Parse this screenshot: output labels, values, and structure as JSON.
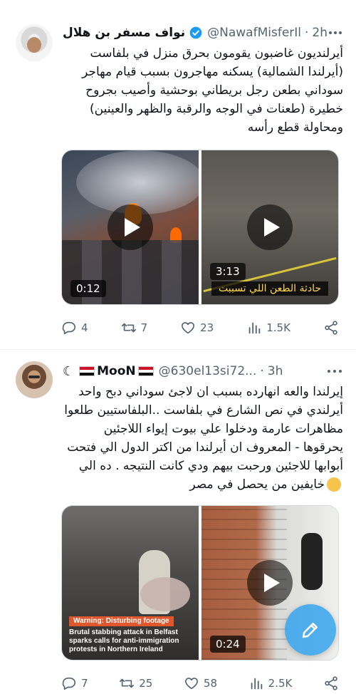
{
  "tweets": [
    {
      "author_name": "نواف مسفر بن هلال",
      "handle": "@NawafMisferIl",
      "time": "2h",
      "body_lines": [
        "أيرلنديون غاضبون يقومون بحرق منزل في بلفاست",
        "(أيرلندا الشمالية) يسكنه مهاجرون بسبب قيام مهاجر",
        "سوداني بطعن رجل بريطاني بوحشية وأصيب بجروح",
        "خطيرة (طعنات في الوجه والرقبة والظهر والعينين)",
        "ومحاولة قطع رأسه"
      ],
      "videos": [
        {
          "duration": "0:12"
        },
        {
          "duration": "3:13",
          "caption": "حادثة الطعن اللي تسببت"
        }
      ],
      "stats": {
        "replies": "4",
        "reposts": "7",
        "likes": "23",
        "views": "1.5K"
      }
    },
    {
      "author_name": "MooN",
      "handle": "@630el13si72...",
      "time": "3h",
      "body_lines": [
        "إيرلندا والعه انهارده بسبب ان لاجئ سوداني دبح واحد",
        "أيرلندي في نص الشارع في بلفاست ..البلفاستيين طلعوا",
        "مظاهرات عارمة ودخلوا علي بيوت إيواء اللاجئين",
        "يحرقوها - المعروف ان أيرلندا من اكتر الدول الي فتحت",
        "أبوابها للاجئين ورحبت بيهم ودي كانت النتيجه . ده الي",
        "خايفين من يحصل في مصر"
      ],
      "videos": [
        {
          "warning": "Warning: Disturbing footage",
          "caption": "Brutal stabbing attack in Belfast sparks calls for anti-immigration protests in Northern Ireland"
        },
        {
          "duration": "0:24"
        }
      ],
      "stats": {
        "replies": "7",
        "reposts": "25",
        "likes": "58",
        "views": "2.5K"
      }
    }
  ],
  "colors": {
    "accent": "#1d9bf0",
    "muted": "#536471",
    "text": "#0f1419",
    "verified": "#1d9bf0"
  },
  "icons": [
    "more-icon",
    "verified-icon",
    "reply-icon",
    "repost-icon",
    "like-icon",
    "views-icon",
    "share-icon",
    "play-icon",
    "compose-icon",
    "moon-emoji",
    "egypt-flag",
    "pleading-emoji"
  ]
}
